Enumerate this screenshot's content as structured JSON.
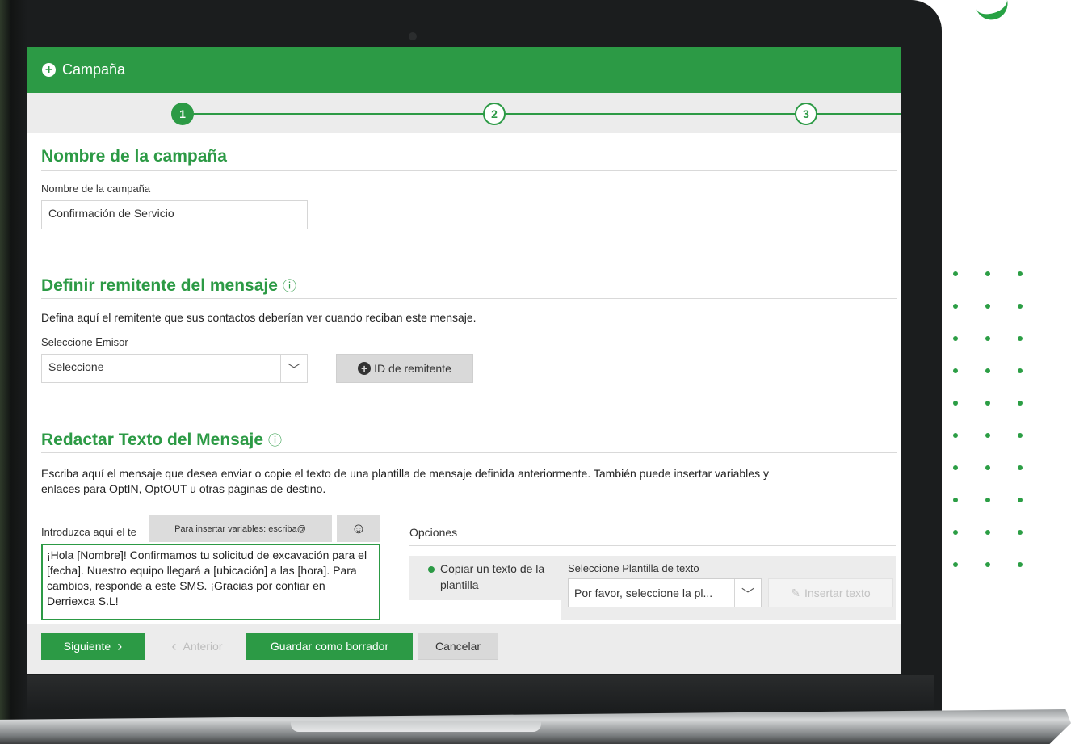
{
  "window": {
    "title": "Campaña"
  },
  "stepper": {
    "steps": [
      "1",
      "2",
      "3"
    ],
    "active_step": 1
  },
  "campaign_name": {
    "section_title": "Nombre de la campaña",
    "field_label": "Nombre de la campaña",
    "field_value": "Confirmación de Servicio"
  },
  "sender": {
    "section_title": "Definir remitente del mensaje",
    "info_icon": "ⓘ",
    "description": "Defina aquí el remitente que sus contactos deberían ver cuando reciban este mensaje.",
    "select_label": "Seleccione Emisor",
    "select_value": "Seleccione",
    "add_sender_button": "ID de remitente"
  },
  "message": {
    "section_title": "Redactar Texto del Mensaje",
    "info_icon": "ⓘ",
    "description_line1": "Escriba aquí el mensaje que desea enviar o copie el texto de una plantilla de mensaje definida anteriormente. También puede insertar variables y",
    "description_line2": "enlaces para OptIN, OptOUT u otras páginas de destino.",
    "textarea_label": "Introduzca aquí el te",
    "variables_hint": "Para insertar variables: escriba@",
    "emoji_icon": "☺",
    "text_value": "¡Hola [Nombre]! Confirmamos tu solicitud de excavación para el [fecha]. Nuestro equipo llegará a [ubicación] a las [hora]. Para cambios, responde a este SMS. ¡Gracias por confiar en Derriexca S.L!"
  },
  "options": {
    "label": "Opciones",
    "radio_label": "Copiar un texto de la plantilla",
    "template_label": "Seleccione Plantilla de texto",
    "template_select_value": "Por favor, seleccione la pl...",
    "insert_text_button": "Insertar texto"
  },
  "footer": {
    "next_button": "Siguiente",
    "prev_button": "Anterior",
    "save_draft_button": "Guardar como borrador",
    "cancel_button": "Cancelar"
  },
  "colors": {
    "accent": "#2c9a45",
    "accent_light": "#27a244",
    "panel_grey": "#ececec"
  }
}
